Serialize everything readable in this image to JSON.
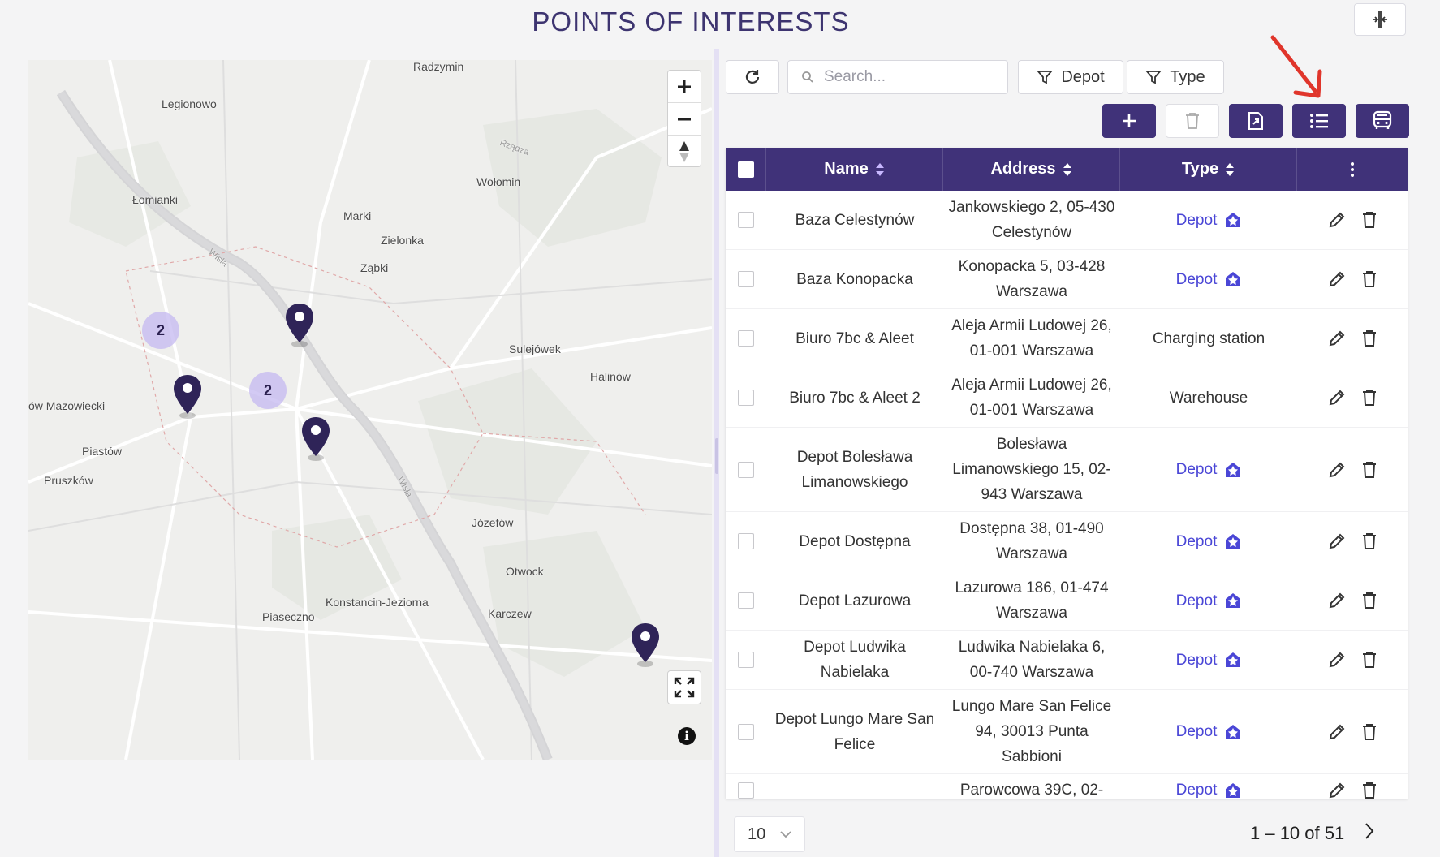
{
  "page": {
    "title": "POINTS OF INTERESTS"
  },
  "map": {
    "places": [
      {
        "name": "Radzymin"
      },
      {
        "name": "Legionowo"
      },
      {
        "name": "Łomianki"
      },
      {
        "name": "Marki"
      },
      {
        "name": "Wołomin"
      },
      {
        "name": "Zielonka"
      },
      {
        "name": "Ząbki"
      },
      {
        "name": "Sulejówek"
      },
      {
        "name": "Halinów"
      },
      {
        "name": "ów Mazowiecki"
      },
      {
        "name": "Piastów"
      },
      {
        "name": "Pruszków"
      },
      {
        "name": "Józefów"
      },
      {
        "name": "Otwock"
      },
      {
        "name": "Konstancin-Jeziorna"
      },
      {
        "name": "Piaseczno"
      },
      {
        "name": "Karczew"
      }
    ],
    "river_labels": [
      "Wisła",
      "Wisła",
      "Rządza"
    ],
    "clusters": [
      {
        "count": "2"
      },
      {
        "count": "2"
      }
    ],
    "info_glyph": "i"
  },
  "toolbar": {
    "search_placeholder": "Search...",
    "depot_filter_label": "Depot",
    "type_filter_label": "Type"
  },
  "table": {
    "headers": {
      "name": "Name",
      "address": "Address",
      "type": "Type"
    },
    "rows": [
      {
        "name": "Baza Celestynów",
        "address": "Jankowskiego 2, 05-430 Celestynów",
        "type": "Depot",
        "is_depot": true
      },
      {
        "name": "Baza Konopacka",
        "address": "Konopacka 5, 03-428 Warszawa",
        "type": "Depot",
        "is_depot": true
      },
      {
        "name": "Biuro 7bc & Aleet",
        "address": "Aleja Armii Ludowej 26, 01-001 Warszawa",
        "type": "Charging station",
        "is_depot": false
      },
      {
        "name": "Biuro 7bc & Aleet 2",
        "address": "Aleja Armii Ludowej 26, 01-001 Warszawa",
        "type": "Warehouse",
        "is_depot": false
      },
      {
        "name": "Depot Bolesława Limanowskiego",
        "address": "Bolesława Limanowskiego 15, 02-943 Warszawa",
        "type": "Depot",
        "is_depot": true
      },
      {
        "name": "Depot Dostępna",
        "address": "Dostępna 38, 01-490 Warszawa",
        "type": "Depot",
        "is_depot": true
      },
      {
        "name": "Depot Lazurowa",
        "address": "Lazurowa 186, 01-474 Warszawa",
        "type": "Depot",
        "is_depot": true
      },
      {
        "name": "Depot Ludwika Nabielaka",
        "address": "Ludwika Nabielaka 6, 00-740 Warszawa",
        "type": "Depot",
        "is_depot": true
      },
      {
        "name": "Depot Lungo Mare San Felice",
        "address": "Lungo Mare San Felice 94, 30013 Punta Sabbioni",
        "type": "Depot",
        "is_depot": true
      },
      {
        "name": "",
        "address": "Parowcowa 39C, 02-",
        "type": "Depot",
        "is_depot": true
      }
    ]
  },
  "pagination": {
    "page_size": "10",
    "range": "1 – 10 of 51"
  },
  "colors": {
    "primary": "#403279",
    "depot_link": "#4a46d6",
    "annotation_arrow": "#e0352b"
  }
}
